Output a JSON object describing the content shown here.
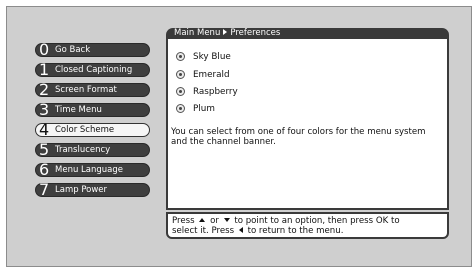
{
  "breadcrumb": {
    "root": "Main Menu",
    "current": "Preferences"
  },
  "menu": {
    "items": [
      {
        "num": "0",
        "label": "Go Back"
      },
      {
        "num": "1",
        "label": "Closed Captioning"
      },
      {
        "num": "2",
        "label": "Screen Format"
      },
      {
        "num": "3",
        "label": "Time Menu"
      },
      {
        "num": "4",
        "label": "Color Scheme"
      },
      {
        "num": "5",
        "label": "Translucency"
      },
      {
        "num": "6",
        "label": "Menu Language"
      },
      {
        "num": "7",
        "label": "Lamp Power"
      }
    ],
    "selected_index": 4
  },
  "options": [
    {
      "label": "Sky Blue",
      "selected": true
    },
    {
      "label": "Emerald",
      "selected": false
    },
    {
      "label": "Raspberry",
      "selected": false
    },
    {
      "label": "Plum",
      "selected": false
    }
  ],
  "description": "You can select from one of four colors for the menu system and the channel banner.",
  "help": {
    "press": "Press",
    "or": "or",
    "point_text": "to point to an option, then press OK to",
    "line2_start": "select it. Press",
    "line2_end": "to return to the menu."
  },
  "colors": {
    "menu_item_bg": "#3f3f3f",
    "selected_item_bg": "#f6f6f6",
    "screen_bg": "#cfcfcf",
    "header_bg": "#3a3a3a"
  }
}
